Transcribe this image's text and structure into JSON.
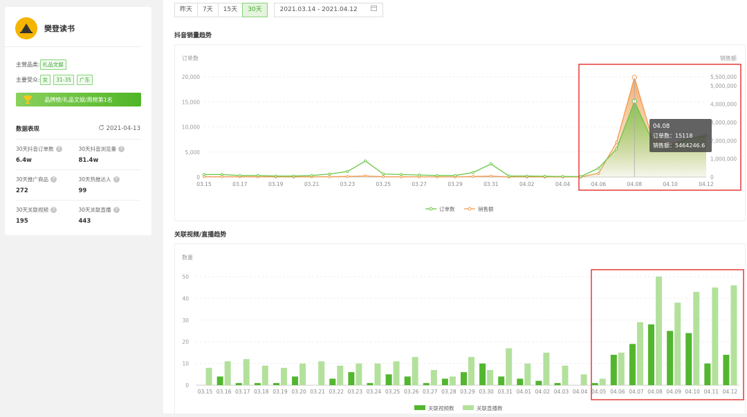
{
  "brand": {
    "name": "樊登读书"
  },
  "category": {
    "label": "主营品类:",
    "tags": [
      "礼品文娱"
    ]
  },
  "audience": {
    "label": "主要受众:",
    "tags": [
      "女",
      "31-35",
      "广东"
    ]
  },
  "rank_banner": "品牌榜/礼品文娱/周榜第1名",
  "performance": {
    "title": "数据表现",
    "date": "2021-04-13",
    "stats": [
      {
        "label": "30天抖音订单数",
        "value": "6.4w"
      },
      {
        "label": "30天抖音浏览量",
        "value": "81.4w"
      },
      {
        "label": "30天推广商品",
        "value": "272"
      },
      {
        "label": "30天热推达人",
        "value": "99"
      },
      {
        "label": "30天关联视频",
        "value": "195"
      },
      {
        "label": "30天关联直播",
        "value": "443"
      }
    ]
  },
  "range_buttons": [
    "昨天",
    "7天",
    "15天",
    "30天"
  ],
  "active_range": "30天",
  "date_range": "2021.03.14 - 2021.04.12",
  "chart_data": [
    {
      "type": "line",
      "title": "抖音销量趋势",
      "ylabel": "订单数",
      "y2label": "销售额",
      "ylim": [
        0,
        20000
      ],
      "y2lim": [
        0,
        5500000
      ],
      "yticks": [
        0,
        5000,
        10000,
        15000,
        20000
      ],
      "y2ticks": [
        0,
        1000000,
        2000000,
        3000000,
        4000000,
        5000000,
        5500000
      ],
      "x": [
        "03.15",
        "03.16",
        "03.17",
        "03.18",
        "03.19",
        "03.20",
        "03.21",
        "03.22",
        "03.23",
        "03.24",
        "03.25",
        "03.26",
        "03.27",
        "03.28",
        "03.29",
        "03.30",
        "03.31",
        "04.01",
        "04.02",
        "04.03",
        "04.04",
        "04.05",
        "04.06",
        "04.07",
        "04.08",
        "04.09",
        "04.10",
        "04.11",
        "04.12"
      ],
      "xticks": [
        "03.15",
        "03.17",
        "03.19",
        "03.21",
        "03.23",
        "03.25",
        "03.27",
        "03.29",
        "03.31",
        "04.02",
        "04.04",
        "04.06",
        "04.08",
        "04.10",
        "04.12"
      ],
      "series": [
        {
          "name": "订单数",
          "axis": "left",
          "color": "#6cc644",
          "values": [
            500,
            500,
            300,
            300,
            200,
            200,
            300,
            600,
            1100,
            3200,
            600,
            500,
            400,
            300,
            300,
            900,
            2600,
            200,
            200,
            150,
            100,
            100,
            1800,
            5600,
            15118,
            7200,
            6200,
            7600,
            8200
          ]
        },
        {
          "name": "销售额",
          "axis": "right",
          "color": "#f39a4e",
          "values": [
            20000,
            20000,
            15000,
            15000,
            10000,
            10000,
            15000,
            20000,
            30000,
            60000,
            20000,
            15000,
            15000,
            10000,
            10000,
            30000,
            50000,
            10000,
            10000,
            8000,
            5000,
            5000,
            200000,
            1900000,
            5464246.6,
            2100000,
            1800000,
            2100000,
            2300000
          ]
        }
      ],
      "tooltip": {
        "date": "04.08",
        "rows": [
          "订单数：15118",
          "销售额：5464246.6"
        ]
      }
    },
    {
      "type": "bar",
      "title": "关联视频/直播趋势",
      "ylabel": "数量",
      "ylim": [
        0,
        50
      ],
      "yticks": [
        0,
        10,
        20,
        30,
        40,
        50
      ],
      "categories": [
        "03.15",
        "03.16",
        "03.17",
        "03.18",
        "03.19",
        "03.20",
        "03.21",
        "03.22",
        "03.23",
        "03.24",
        "03.25",
        "03.26",
        "03.27",
        "03.28",
        "03.29",
        "03.30",
        "03.31",
        "04.01",
        "04.02",
        "04.03",
        "04.04",
        "04.05",
        "04.06",
        "04.07",
        "04.08",
        "04.09",
        "04.10",
        "04.11",
        "04.12"
      ],
      "series": [
        {
          "name": "关联视频数",
          "color": "#52b62f",
          "values": [
            0,
            4,
            1,
            1,
            1,
            4,
            0,
            3,
            6,
            1,
            5,
            4,
            1,
            3,
            6,
            10,
            4,
            3,
            2,
            1,
            0,
            1,
            14,
            19,
            28,
            25,
            24,
            10,
            14
          ]
        },
        {
          "name": "关联直播数",
          "color": "#b3e19c",
          "values": [
            8,
            11,
            12,
            9,
            8,
            10,
            11,
            9,
            10,
            10,
            11,
            13,
            7,
            4,
            13,
            7,
            17,
            10,
            15,
            9,
            5,
            3,
            15,
            29,
            50,
            38,
            43,
            45,
            46
          ]
        }
      ]
    }
  ]
}
